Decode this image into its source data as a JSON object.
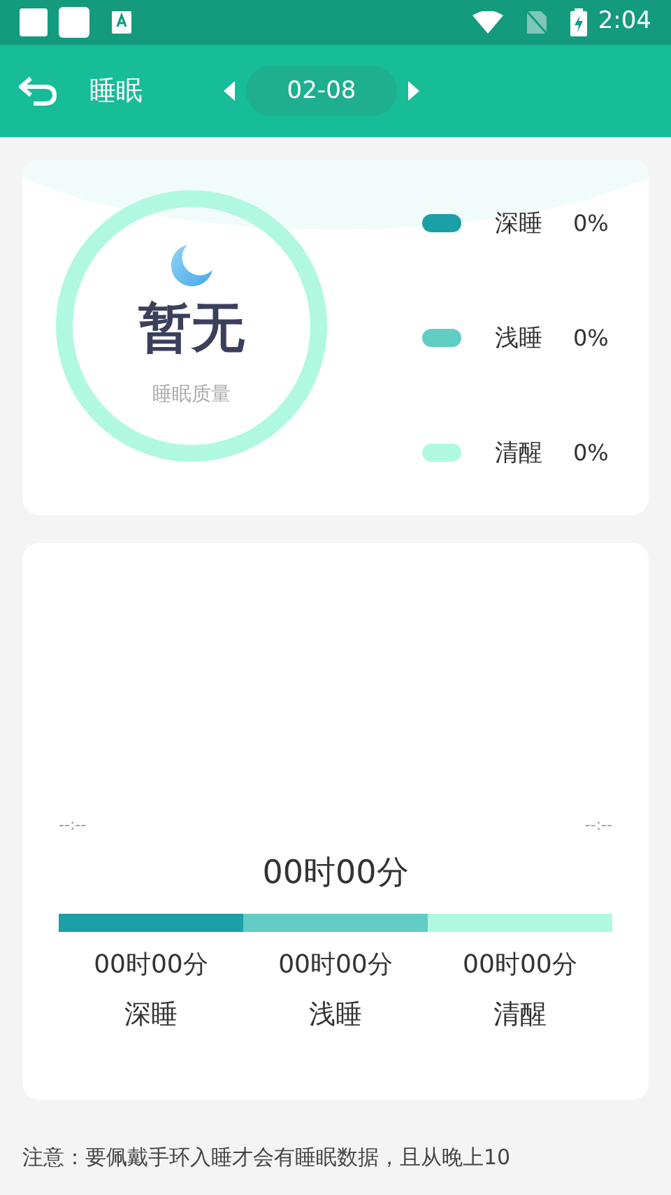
{
  "status_bar": {
    "time": "2:04"
  },
  "app_bar": {
    "title": "睡眠",
    "date": "02-08"
  },
  "quality": {
    "value": "暂无",
    "label": "睡眠质量"
  },
  "legend": [
    {
      "name": "深睡",
      "percent": "0%",
      "color": "#1ba0a6"
    },
    {
      "name": "浅睡",
      "percent": "0%",
      "color": "#62cdc4"
    },
    {
      "name": "清醒",
      "percent": "0%",
      "color": "#b0f8e0"
    }
  ],
  "timeline": {
    "start": "--:--",
    "end": "--:--",
    "total": "00时00分"
  },
  "stages": [
    {
      "duration": "00时00分",
      "name": "深睡",
      "color": "#1ba0a6"
    },
    {
      "duration": "00时00分",
      "name": "浅睡",
      "color": "#62cdc4"
    },
    {
      "duration": "00时00分",
      "name": "清醒",
      "color": "#b0f8e0"
    }
  ],
  "note": "注意：要佩戴手环入睡才会有睡眠数据，且从晚上10"
}
